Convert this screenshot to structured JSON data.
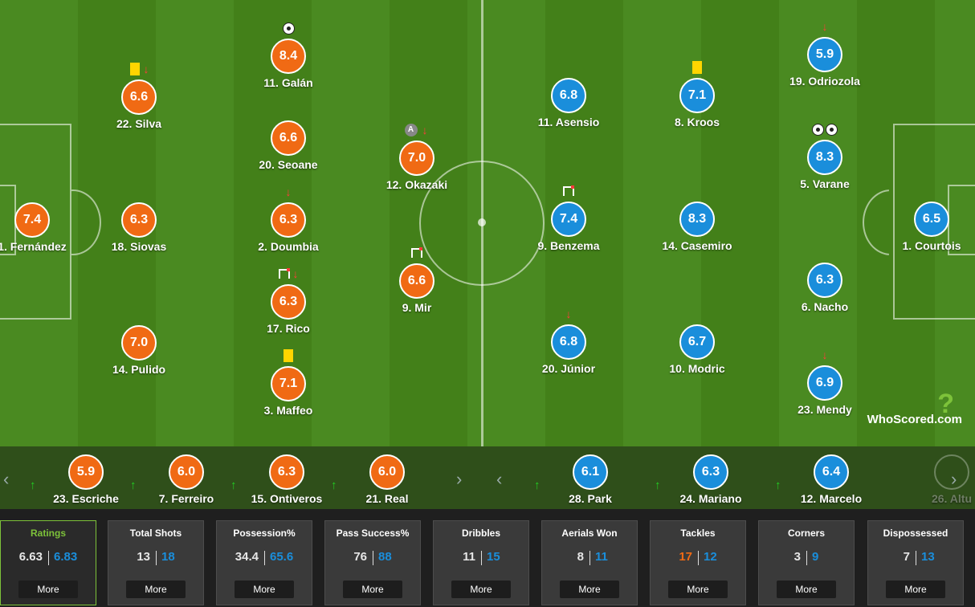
{
  "branding": {
    "logo_text": "WhoScored",
    "logo_suffix": ".com",
    "logo_mark": "?"
  },
  "home_players": [
    {
      "number_name": "1. Fernández",
      "rating": "7.4",
      "icons": []
    },
    {
      "number_name": "22. Silva",
      "rating": "6.6",
      "icons": [
        "yellow-card",
        "sub-off"
      ]
    },
    {
      "number_name": "18. Siovas",
      "rating": "6.3",
      "icons": []
    },
    {
      "number_name": "14. Pulido",
      "rating": "7.0",
      "icons": []
    },
    {
      "number_name": "11. Galán",
      "rating": "8.4",
      "icons": [
        "goal"
      ]
    },
    {
      "number_name": "20. Seoane",
      "rating": "6.6",
      "icons": []
    },
    {
      "number_name": "2. Doumbia",
      "rating": "6.3",
      "icons": [
        "sub-off"
      ]
    },
    {
      "number_name": "17. Rico",
      "rating": "6.3",
      "icons": [
        "corner-flag",
        "sub-off"
      ]
    },
    {
      "number_name": "3. Maffeo",
      "rating": "7.1",
      "icons": [
        "yellow-card"
      ]
    },
    {
      "number_name": "12. Okazaki",
      "rating": "7.0",
      "icons": [
        "captain",
        "sub-off"
      ]
    },
    {
      "number_name": "9. Mir",
      "rating": "6.6",
      "icons": [
        "corner-flag"
      ]
    }
  ],
  "away_players": [
    {
      "number_name": "11. Asensio",
      "rating": "6.8",
      "icons": []
    },
    {
      "number_name": "9. Benzema",
      "rating": "7.4",
      "icons": [
        "corner-flag"
      ]
    },
    {
      "number_name": "20. Júnior",
      "rating": "6.8",
      "icons": [
        "sub-off"
      ]
    },
    {
      "number_name": "8. Kroos",
      "rating": "7.1",
      "icons": [
        "yellow-card"
      ]
    },
    {
      "number_name": "14. Casemiro",
      "rating": "8.3",
      "icons": []
    },
    {
      "number_name": "10. Modric",
      "rating": "6.7",
      "icons": []
    },
    {
      "number_name": "19. Odriozola",
      "rating": "5.9",
      "icons": [
        "sub-off"
      ]
    },
    {
      "number_name": "5. Varane",
      "rating": "8.3",
      "icons": [
        "goal",
        "goal"
      ]
    },
    {
      "number_name": "6. Nacho",
      "rating": "6.3",
      "icons": []
    },
    {
      "number_name": "23. Mendy",
      "rating": "6.9",
      "icons": [
        "sub-off"
      ]
    },
    {
      "number_name": "1. Courtois",
      "rating": "6.5",
      "icons": []
    }
  ],
  "home_subs": [
    {
      "number_name": "23. Escriche",
      "rating": "5.9"
    },
    {
      "number_name": "7. Ferreiro",
      "rating": "6.0"
    },
    {
      "number_name": "15. Ontiveros",
      "rating": "6.3"
    },
    {
      "number_name": "21. Real",
      "rating": "6.0"
    }
  ],
  "away_subs": [
    {
      "number_name": "28. Park",
      "rating": "6.1"
    },
    {
      "number_name": "24. Mariano",
      "rating": "6.3"
    },
    {
      "number_name": "12. Marcelo",
      "rating": "6.4"
    },
    {
      "number_name": "26. Altu",
      "rating": ""
    }
  ],
  "icons": {
    "sub_on": "up-arrow-icon",
    "sub_off": "down-arrow-icon",
    "prev": "chevron-left-icon",
    "next": "chevron-right-icon"
  },
  "stats": [
    {
      "title": "Ratings",
      "home": "6.63",
      "away": "6.83",
      "more": "More",
      "active": true
    },
    {
      "title": "Total Shots",
      "home": "13",
      "away": "18",
      "more": "More"
    },
    {
      "title": "Possession%",
      "home": "34.4",
      "away": "65.6",
      "more": "More"
    },
    {
      "title": "Pass Success%",
      "home": "76",
      "away": "88",
      "more": "More"
    },
    {
      "title": "Dribbles",
      "home": "11",
      "away": "15",
      "more": "More"
    },
    {
      "title": "Aerials Won",
      "home": "8",
      "away": "11",
      "more": "More"
    },
    {
      "title": "Tackles",
      "home": "17",
      "away": "12",
      "more": "More",
      "home_color": "#f06a14"
    },
    {
      "title": "Corners",
      "home": "3",
      "away": "9",
      "more": "More"
    },
    {
      "title": "Dispossessed",
      "home": "7",
      "away": "13",
      "more": "More"
    }
  ],
  "colors": {
    "home": "#f06a14",
    "away": "#1a8edb",
    "accent": "#7dc23a",
    "pitch": "#4a8a21"
  }
}
